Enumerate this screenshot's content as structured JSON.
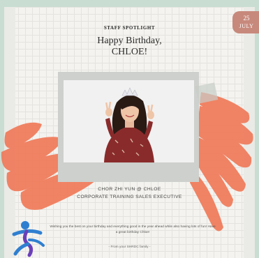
{
  "card": {
    "kicker": "STAFF SPOTLIGHT",
    "title_line1": "Happy Birthday,",
    "title_line2": "CHLOE!",
    "date_day": "25",
    "date_month": "JULY",
    "name": "CHOR ZHI YUN @ CHLOE",
    "role": "CORPORATE TRAINING SALES EXECUTIVE",
    "message": "Wishing you the best on your birthday and everything good in the year ahead while also having lots of fun! Have a great birthday Chloe!",
    "signoff": "- From your SHRDC family -"
  },
  "colors": {
    "background": "#c9ddd2",
    "paper": "#f4f3ef",
    "accent_stroke": "#f07a59",
    "date_badge": "#c7897c",
    "logo_blue": "#2f7fd0",
    "logo_purple": "#6b3fb8"
  },
  "icons": {
    "logo": "shrdc-figure-logo",
    "tiara": "tiara-icon"
  }
}
